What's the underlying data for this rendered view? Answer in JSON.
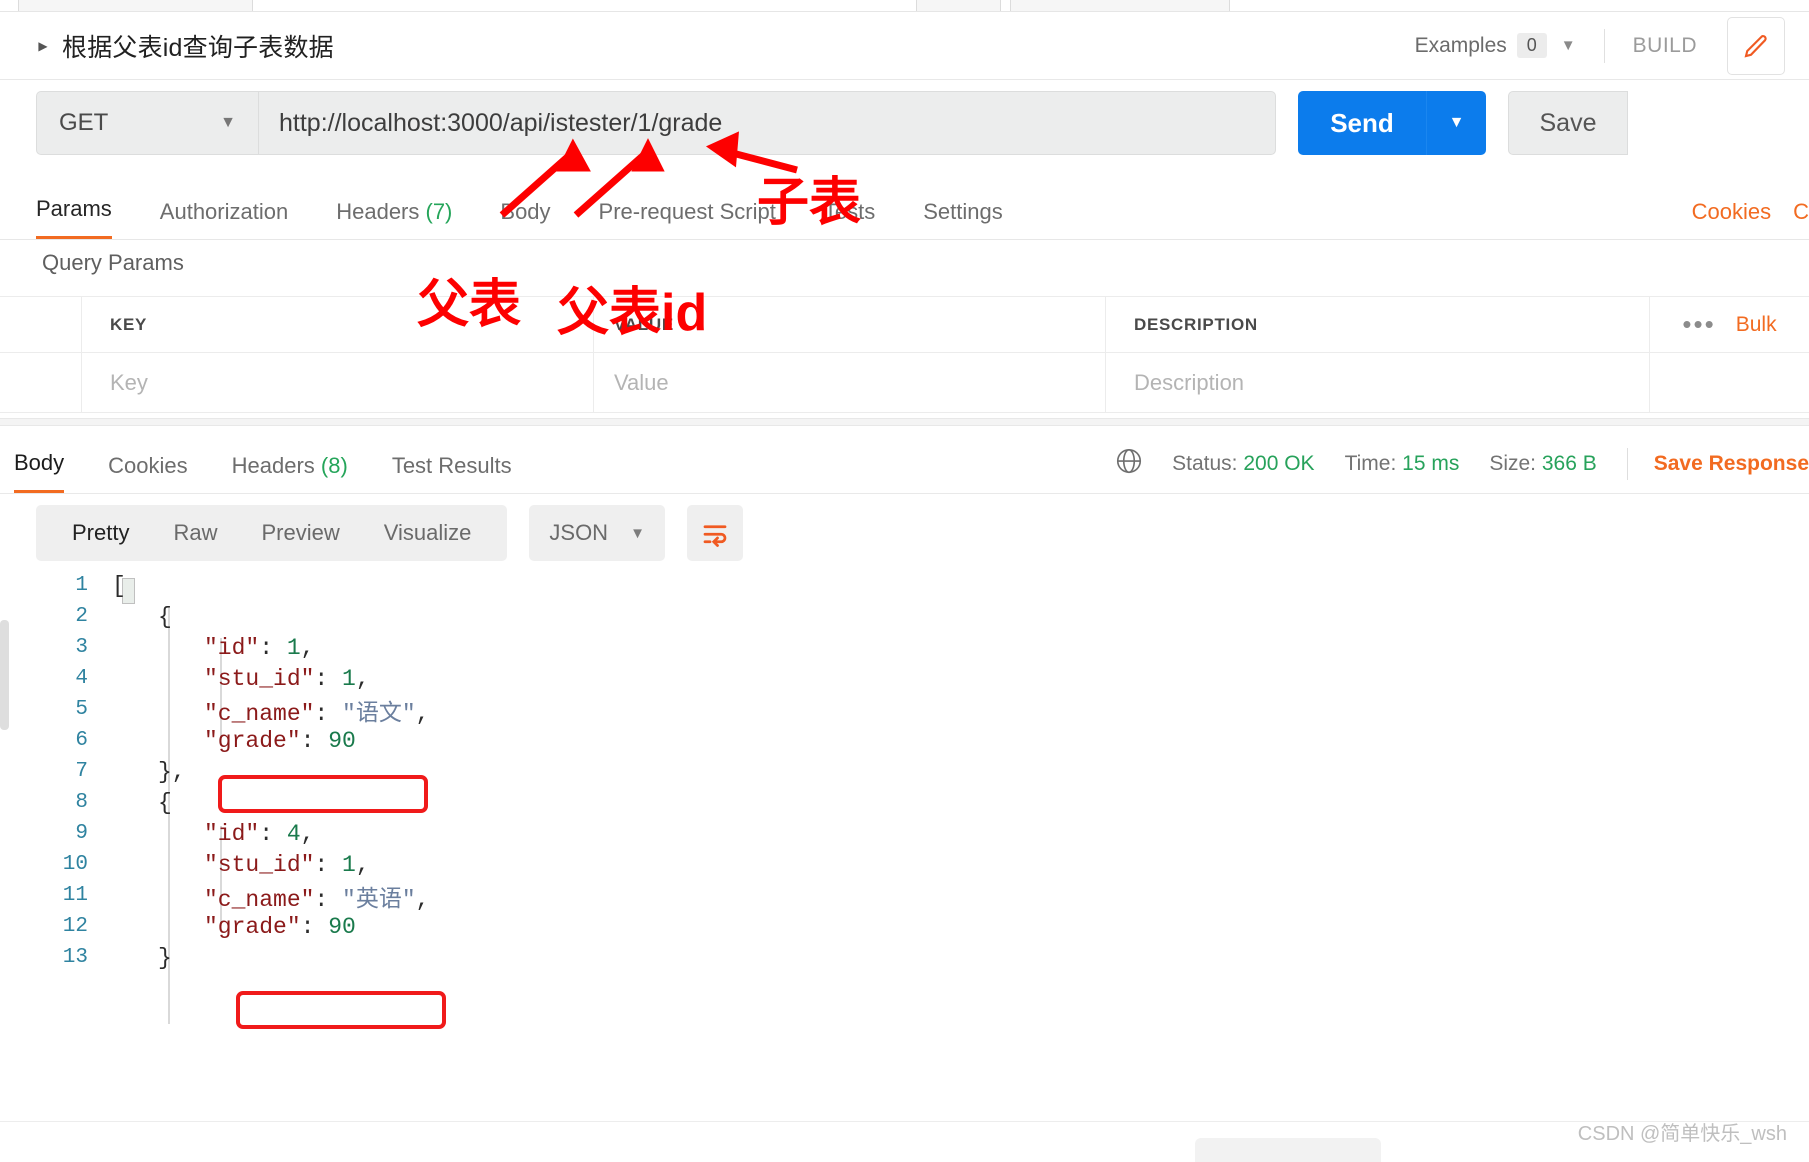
{
  "request": {
    "title": "根据父表id查询子表数据",
    "collapse_icon": "triangle-right-icon",
    "examples_label": "Examples",
    "examples_count": "0",
    "examples_caret": "chevron-down-icon",
    "build_label": "BUILD",
    "edit_icon": "pencil-icon",
    "method": "GET",
    "method_caret": "chevron-down-icon",
    "url": "http://localhost:3000/api/istester/1/grade",
    "send_label": "Send",
    "send_caret": "chevron-down-icon",
    "save_label": "Save",
    "tabs": [
      {
        "label": "Params",
        "count": "",
        "active": true
      },
      {
        "label": "Authorization",
        "count": "",
        "active": false
      },
      {
        "label": "Headers",
        "count": "(7)",
        "active": false
      },
      {
        "label": "Body",
        "count": "",
        "active": false
      },
      {
        "label": "Pre-request Script",
        "count": "",
        "active": false
      },
      {
        "label": "Tests",
        "count": "",
        "active": false
      },
      {
        "label": "Settings",
        "count": "",
        "active": false
      }
    ],
    "cookies_link": "Cookies",
    "cookies_cut": "C"
  },
  "query_params": {
    "section_title": "Query Params",
    "headers": [
      "KEY",
      "VALUE",
      "DESCRIPTION"
    ],
    "row_placeholders": [
      "Key",
      "Value",
      "Description"
    ],
    "more_icon": "ellipsis-icon",
    "bulk_label": "Bulk"
  },
  "response": {
    "tabs": [
      {
        "label": "Body",
        "count": "",
        "active": true
      },
      {
        "label": "Cookies",
        "count": "",
        "active": false
      },
      {
        "label": "Headers",
        "count": "(8)",
        "active": false
      },
      {
        "label": "Test Results",
        "count": "",
        "active": false
      }
    ],
    "globe_icon": "globe-icon",
    "status_label": "Status:",
    "status_value": "200 OK",
    "time_label": "Time:",
    "time_value": "15 ms",
    "size_label": "Size:",
    "size_value": "366 B",
    "save_response_label": "Save Response",
    "view_modes": [
      {
        "label": "Pretty",
        "active": true
      },
      {
        "label": "Raw",
        "active": false
      },
      {
        "label": "Preview",
        "active": false
      },
      {
        "label": "Visualize",
        "active": false
      }
    ],
    "format": "JSON",
    "format_caret": "chevron-down-icon",
    "wrap_icon": "word-wrap-icon",
    "copy_icon": "copy-icon",
    "code_lines": [
      {
        "n": "1",
        "indent": 0,
        "tokens": [
          {
            "t": "[",
            "c": "pun"
          }
        ]
      },
      {
        "n": "2",
        "indent": 1,
        "tokens": [
          {
            "t": "{",
            "c": "pun"
          }
        ]
      },
      {
        "n": "3",
        "indent": 2,
        "tokens": [
          {
            "t": "\"id\"",
            "c": "k"
          },
          {
            "t": ": ",
            "c": "pun"
          },
          {
            "t": "1",
            "c": "num"
          },
          {
            "t": ",",
            "c": "pun"
          }
        ]
      },
      {
        "n": "4",
        "indent": 2,
        "tokens": [
          {
            "t": "\"stu_id\"",
            "c": "k"
          },
          {
            "t": ": ",
            "c": "pun"
          },
          {
            "t": "1",
            "c": "num"
          },
          {
            "t": ",",
            "c": "pun"
          }
        ]
      },
      {
        "n": "5",
        "indent": 2,
        "tokens": [
          {
            "t": "\"c_name\"",
            "c": "k"
          },
          {
            "t": ": ",
            "c": "pun"
          },
          {
            "t": "\"语文\"",
            "c": "str"
          },
          {
            "t": ",",
            "c": "pun"
          }
        ]
      },
      {
        "n": "6",
        "indent": 2,
        "tokens": [
          {
            "t": "\"grade\"",
            "c": "k"
          },
          {
            "t": ": ",
            "c": "pun"
          },
          {
            "t": "90",
            "c": "num"
          }
        ]
      },
      {
        "n": "7",
        "indent": 1,
        "tokens": [
          {
            "t": "},",
            "c": "pun"
          }
        ]
      },
      {
        "n": "8",
        "indent": 1,
        "tokens": [
          {
            "t": "{",
            "c": "pun"
          }
        ]
      },
      {
        "n": "9",
        "indent": 2,
        "tokens": [
          {
            "t": "\"id\"",
            "c": "k"
          },
          {
            "t": ": ",
            "c": "pun"
          },
          {
            "t": "4",
            "c": "num"
          },
          {
            "t": ",",
            "c": "pun"
          }
        ]
      },
      {
        "n": "10",
        "indent": 2,
        "tokens": [
          {
            "t": "\"stu_id\"",
            "c": "k"
          },
          {
            "t": ": ",
            "c": "pun"
          },
          {
            "t": "1",
            "c": "num"
          },
          {
            "t": ",",
            "c": "pun"
          }
        ]
      },
      {
        "n": "11",
        "indent": 2,
        "tokens": [
          {
            "t": "\"c_name\"",
            "c": "k"
          },
          {
            "t": ": ",
            "c": "pun"
          },
          {
            "t": "\"英语\"",
            "c": "str"
          },
          {
            "t": ",",
            "c": "pun"
          }
        ]
      },
      {
        "n": "12",
        "indent": 2,
        "tokens": [
          {
            "t": "\"grade\"",
            "c": "k"
          },
          {
            "t": ": ",
            "c": "pun"
          },
          {
            "t": "90",
            "c": "num"
          }
        ]
      },
      {
        "n": "13",
        "indent": 1,
        "tokens": [
          {
            "t": "}",
            "c": "pun"
          }
        ]
      }
    ]
  },
  "annotations": {
    "child_table": "子表",
    "parent_table": "父表",
    "parent_table_id": "父表id"
  },
  "watermark": "CSDN @简单快乐_wsh",
  "colors": {
    "accent_orange": "#f26b21",
    "send_blue": "#0c7cec",
    "status_green": "#27a25b",
    "annotation_red": "#fd0000",
    "json_key": "#8b1a1a",
    "json_number": "#1a7a4c",
    "json_string": "#6b7f9e",
    "line_number": "#2f83a0"
  }
}
